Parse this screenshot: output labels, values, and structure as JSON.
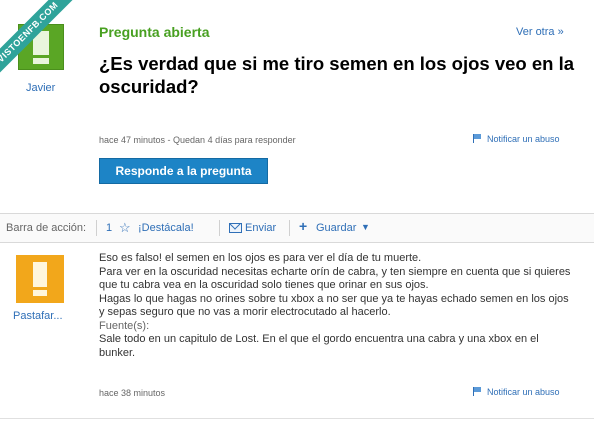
{
  "watermark": {
    "text": "VISTOENFB.COM"
  },
  "question": {
    "header": "Pregunta abierta",
    "see_other": "Ver otra »",
    "title": "¿Es verdad que si me tiro semen en los ojos veo en la oscuridad?",
    "user": "Javier",
    "meta": "hace 47 minutos - Quedan 4 días para responder",
    "report": "Notificar un abuso",
    "answer_button": "Responde a la pregunta"
  },
  "action_bar": {
    "label": "Barra de acción:",
    "count": "1",
    "feature": "¡Destácala!",
    "send": "Enviar",
    "save": "Guardar"
  },
  "answer": {
    "user": "Pastafar...",
    "lines": [
      "Eso es falso! el semen en los ojos es para ver el día de tu muerte.",
      "Para ver en la oscuridad necesitas echarte orín de cabra, y ten siempre en cuenta que si quieres que tu cabra vea en la oscuridad solo tienes que orinar en sus ojos.",
      "Hagas lo que hagas no orines sobre tu xbox a no ser que ya te hayas echado semen en los ojos y sepas seguro que no vas a morir electrocutado al hacerlo."
    ],
    "source_label": "Fuente(s):",
    "source": "Sale todo en un capitulo de Lost. En el que el gordo encuentra una cabra y una xbox en el bunker.",
    "meta": "hace 38 minutos",
    "report": "Notificar un abuso"
  },
  "colors": {
    "header_green": "#48a021",
    "link_blue": "#2f6fb7",
    "button_blue": "#1d84c6",
    "answer_avatar": "#f2a71b",
    "question_avatar": "#5aa625",
    "watermark": "#2fa39a"
  }
}
